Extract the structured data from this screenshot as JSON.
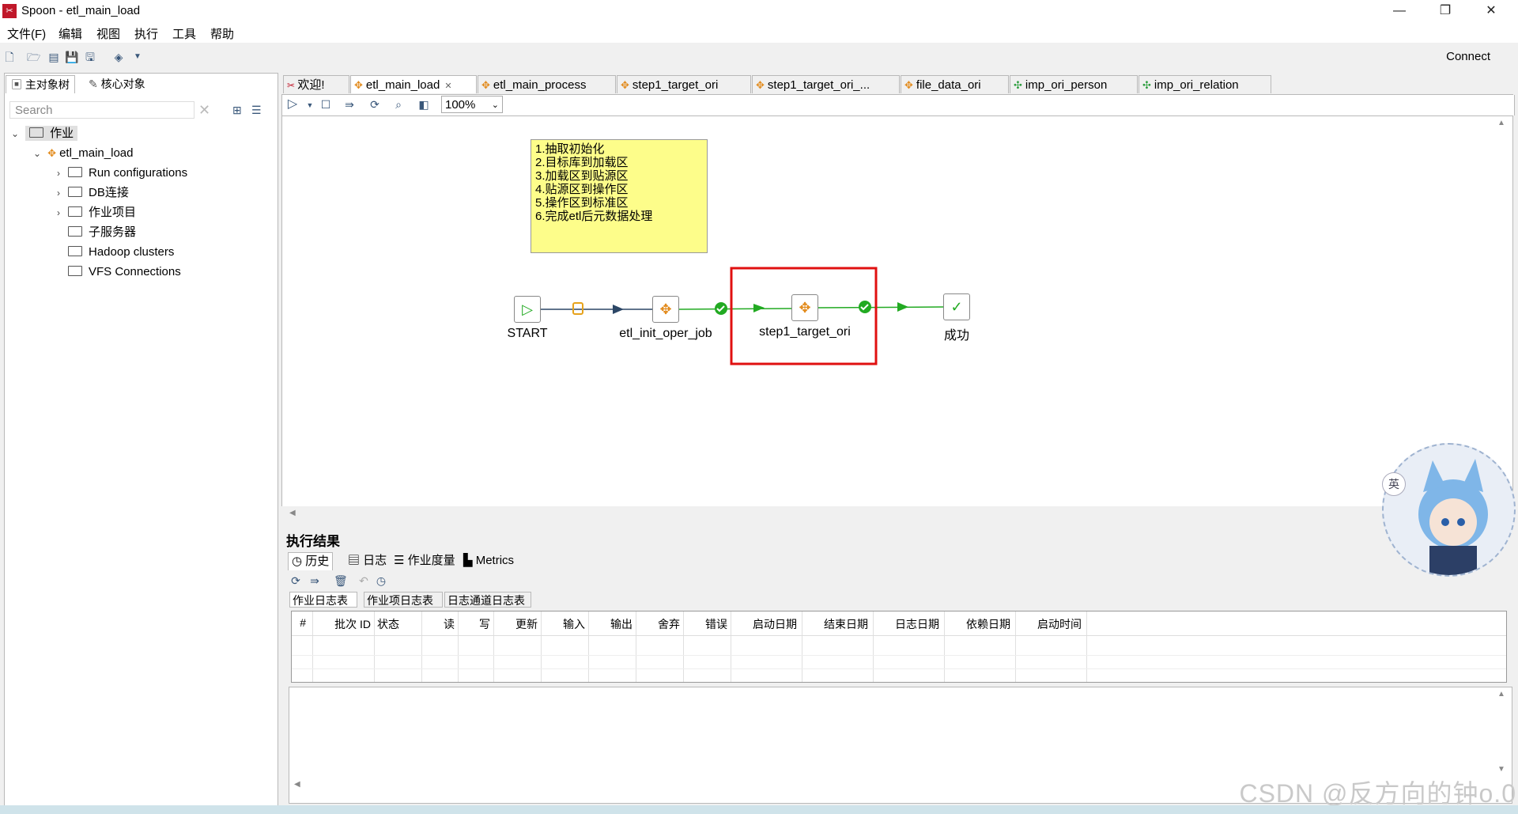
{
  "window": {
    "app_icon": "spoon-logo",
    "title": "Spoon - etl_main_load",
    "controls": [
      "—",
      "❐",
      "✕"
    ]
  },
  "menu": [
    "文件(F)",
    "编辑",
    "视图",
    "执行",
    "工具",
    "帮助"
  ],
  "toolbar": {
    "connect_label": "Connect"
  },
  "left_panel": {
    "tabs": [
      "主对象树",
      "核心对象"
    ],
    "search_placeholder": "Search",
    "tree": {
      "root": "作业",
      "job": "etl_main_load",
      "children": [
        "Run configurations",
        "DB连接",
        "作业项目",
        "子服务器",
        "Hadoop clusters",
        "VFS Connections"
      ]
    }
  },
  "editor_tabs": [
    "欢迎!",
    "etl_main_load",
    "etl_main_process",
    "step1_target_ori",
    "step1_target_ori_...",
    "file_data_ori",
    "imp_ori_person",
    "imp_ori_relation"
  ],
  "canvas": {
    "zoom": "100%",
    "note_lines": [
      "1.抽取初始化",
      "2.目标库到加载区",
      "3.加载区到贴源区",
      "4.贴源区到操作区",
      "5.操作区到标准区",
      "6.完成etl后元数据处理"
    ],
    "nodes": [
      "START",
      "etl_init_oper_job",
      "step1_target_ori",
      "成功"
    ],
    "colors": {
      "highlight": "#e01010",
      "hop_green": "#22aa22",
      "hop_dark": "#2c4766",
      "note": "#fdfd8a"
    }
  },
  "results": {
    "title": "执行结果",
    "tabs": [
      "历史",
      "日志",
      "作业度量",
      "Metrics"
    ],
    "subtabs": [
      "作业日志表",
      "作业项日志表",
      "日志通道日志表"
    ],
    "columns": [
      "#",
      "批次 ID",
      "状态",
      "读",
      "写",
      "更新",
      "输入",
      "输出",
      "舍弃",
      "错误",
      "启动日期",
      "结束日期",
      "日志日期",
      "依赖日期",
      "启动时间"
    ]
  },
  "watermark": "CSDN @反方向的钟o.0",
  "ime_badge": "英"
}
